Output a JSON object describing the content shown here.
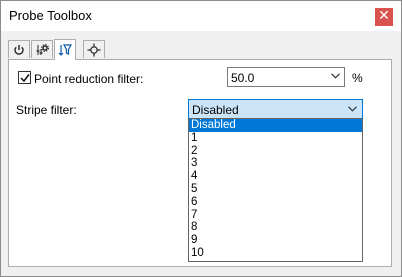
{
  "window": {
    "title": "Probe Toolbox",
    "close_glyph": "✕"
  },
  "tabs": [
    {
      "icon": "power-icon",
      "active": false
    },
    {
      "icon": "gear-sliders-icon",
      "active": false
    },
    {
      "icon": "filter-icon",
      "active": true
    },
    {
      "icon": "crosshair-icon",
      "active": false
    }
  ],
  "point_reduction": {
    "checked": true,
    "label": "Point reduction filter:",
    "value": "50.0",
    "unit": "%"
  },
  "stripe_filter": {
    "label": "Stripe filter:",
    "selected": "Disabled",
    "options": [
      "Disabled",
      "1",
      "2",
      "3",
      "4",
      "5",
      "6",
      "7",
      "8",
      "9",
      "10"
    ]
  },
  "colors": {
    "accent": "#0078d7",
    "selection_bg": "#cce4f7",
    "close_bg": "#d9534f",
    "window_bg": "#f0f0f0"
  }
}
